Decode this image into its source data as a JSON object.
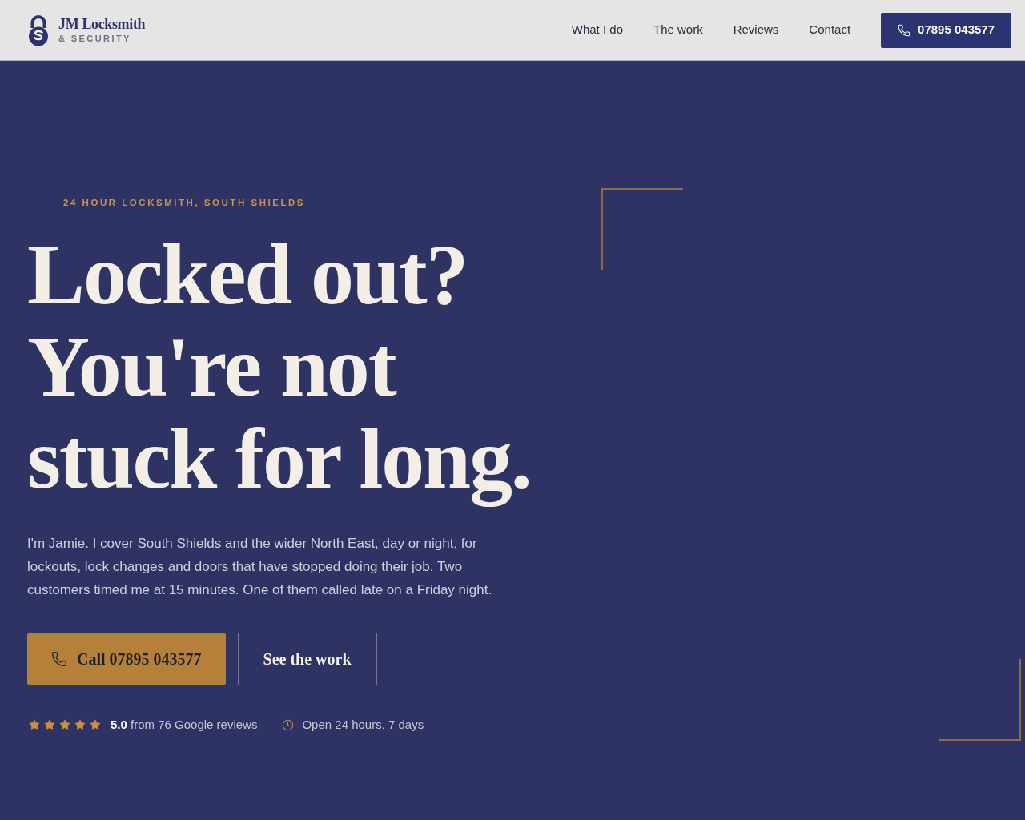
{
  "header": {
    "logo": {
      "name": "JM Locksmith",
      "tagline": "& SECURITY"
    },
    "nav": [
      {
        "label": "What I do"
      },
      {
        "label": "The work"
      },
      {
        "label": "Reviews"
      },
      {
        "label": "Contact"
      }
    ],
    "phone_button": {
      "label": "07895 043577"
    }
  },
  "hero": {
    "eyebrow": "24 HOUR LOCKSMITH, SOUTH SHIELDS",
    "headline": "Locked out? You're not stuck for long.",
    "intro": "I'm Jamie. I cover South Shields and the wider North East, day or night, for lockouts, lock changes and doors that have stopped doing their job. Two customers timed me at 15 minutes. One of them called late on a Friday night.",
    "buttons": [
      {
        "kind": "primary",
        "label": "Call 07895 043577"
      },
      {
        "kind": "outline",
        "label": "See the work"
      }
    ],
    "rating": {
      "stars": 5,
      "text": "**5.0** from 76 Google reviews"
    },
    "hours": "Open 24 hours, 7 days"
  }
}
